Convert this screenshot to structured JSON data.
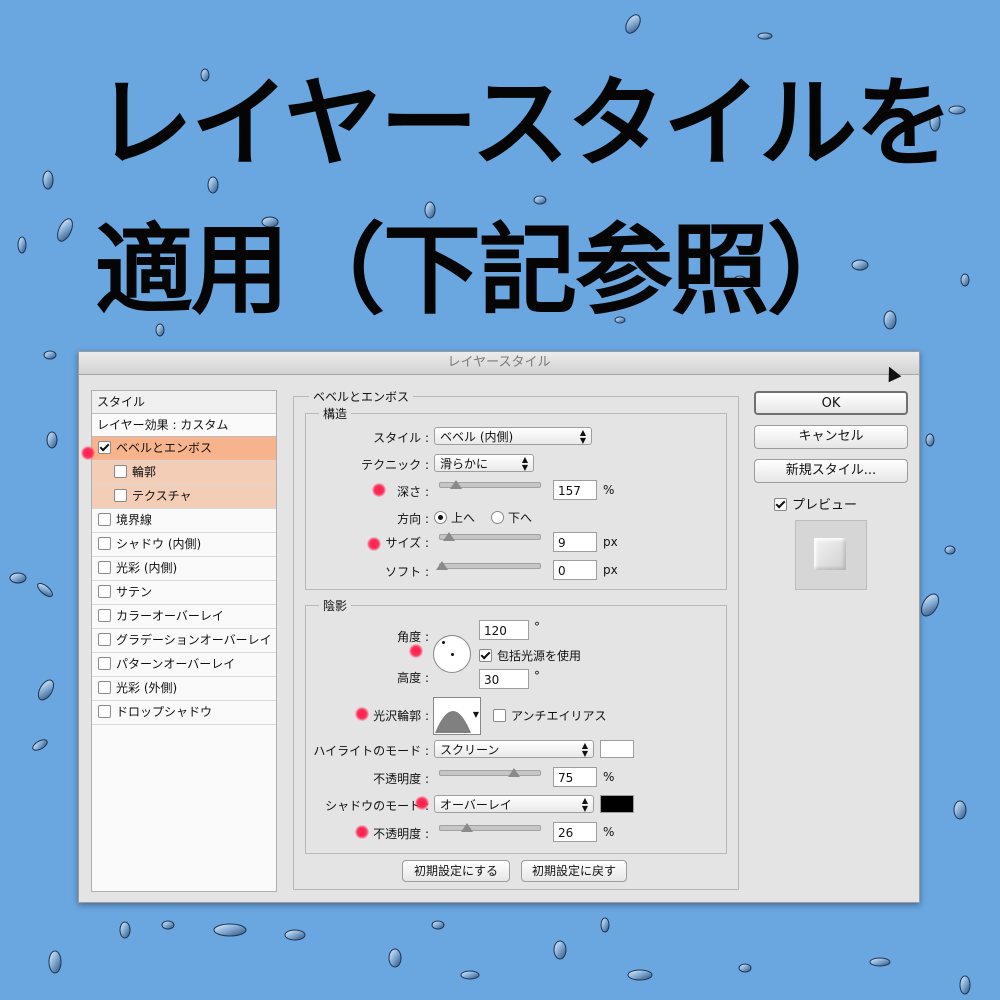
{
  "headline": {
    "line1": "レイヤースタイルを",
    "line2": "適用（下記参照）"
  },
  "colors": {
    "background": "#6aa6e0",
    "active_row": "#f7b48c",
    "sub_row": "#f3cdb6",
    "marker": "#ff2d58",
    "highlight_color": "#ffffff",
    "shadow_color": "#000000"
  },
  "dialog": {
    "title": "レイヤースタイル",
    "left_panel": {
      "header": "スタイル",
      "effects_header": "レイヤー効果 : カスタム",
      "items": [
        {
          "label": "ベベルとエンボス",
          "checked": true
        },
        {
          "label": "輪郭",
          "checked": false
        },
        {
          "label": "テクスチャ",
          "checked": false
        },
        {
          "label": "境界線",
          "checked": false
        },
        {
          "label": "シャドウ (内側)",
          "checked": false
        },
        {
          "label": "光彩 (内側)",
          "checked": false
        },
        {
          "label": "サテン",
          "checked": false
        },
        {
          "label": "カラーオーバーレイ",
          "checked": false
        },
        {
          "label": "グラデーションオーバーレイ",
          "checked": false
        },
        {
          "label": "パターンオーバーレイ",
          "checked": false
        },
        {
          "label": "光彩 (外側)",
          "checked": false
        },
        {
          "label": "ドロップシャドウ",
          "checked": false
        }
      ]
    },
    "bevel": {
      "section_title": "ベベルとエンボス",
      "structure": {
        "title": "構造",
        "style_label": "スタイル :",
        "style_value": "ベベル (内側)",
        "technique_label": "テクニック :",
        "technique_value": "滑らかに",
        "depth_label": "深さ :",
        "depth_value": "157",
        "depth_unit": "%",
        "direction_label": "方向 :",
        "direction_up": "上へ",
        "direction_down": "下へ",
        "size_label": "サイズ :",
        "size_value": "9",
        "size_unit": "px",
        "soften_label": "ソフト :",
        "soften_value": "0",
        "soften_unit": "px"
      },
      "shading": {
        "title": "陰影",
        "angle_label": "角度 :",
        "angle_value": "120",
        "angle_unit": "°",
        "global_light_label": "包括光源を使用",
        "altitude_label": "高度 :",
        "altitude_value": "30",
        "altitude_unit": "°",
        "gloss_label": "光沢輪郭 :",
        "antialias_label": "アンチエイリアス",
        "highlight_mode_label": "ハイライトのモード :",
        "highlight_mode_value": "スクリーン",
        "highlight_opacity_label": "不透明度 :",
        "highlight_opacity_value": "75",
        "highlight_opacity_unit": "%",
        "shadow_mode_label": "シャドウのモード :",
        "shadow_mode_value": "オーバーレイ",
        "shadow_opacity_label": "不透明度 :",
        "shadow_opacity_value": "26",
        "shadow_opacity_unit": "%"
      },
      "make_default": "初期設定にする",
      "reset_default": "初期設定に戻す"
    },
    "buttons": {
      "ok": "OK",
      "cancel": "キャンセル",
      "new_style": "新規スタイル..."
    },
    "preview_label": "プレビュー",
    "sliders": {
      "depth": 0.15,
      "size": 0.07,
      "soften": 0.0,
      "highlight_opacity": 0.75,
      "shadow_opacity": 0.26
    }
  }
}
